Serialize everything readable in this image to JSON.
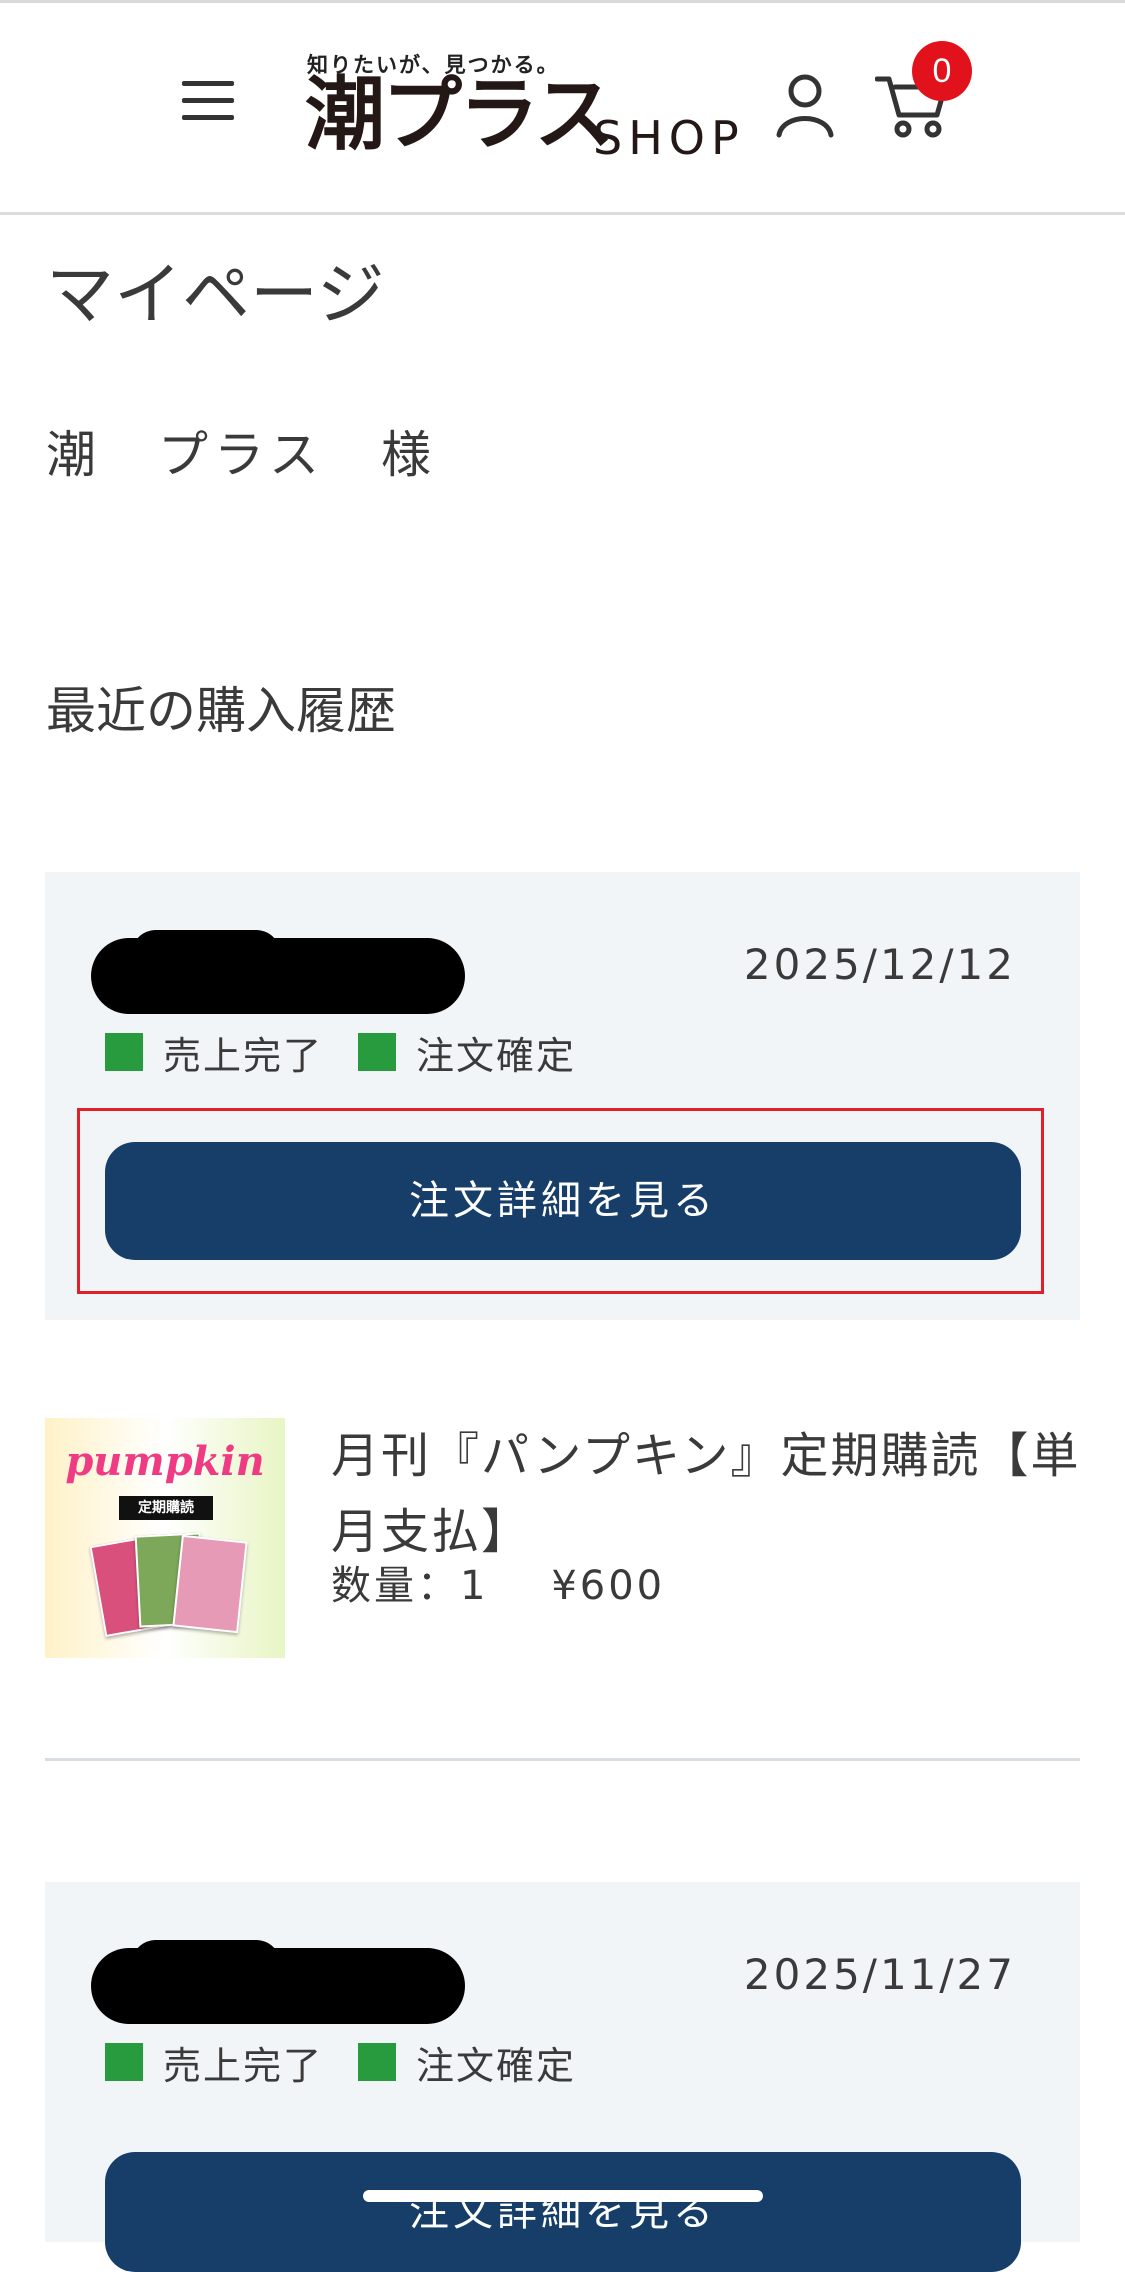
{
  "header": {
    "logo_tagline": "知りたいが、見つかる。",
    "logo_main": "潮プラス",
    "logo_shop": "SHOP",
    "cart_count": "0",
    "icons": {
      "menu": "hamburger-menu-icon",
      "user": "user-icon",
      "cart": "cart-icon"
    }
  },
  "page": {
    "title": "マイページ",
    "user_name": "潮　プラス　様",
    "section_title": "最近の購入履歴"
  },
  "orders": [
    {
      "date": "2025/12/12",
      "statuses": [
        "売上完了",
        "注文確定"
      ],
      "detail_label": "注文詳細を見る",
      "items": [
        {
          "name": "月刊『パンプキン』定期購読【単月支払】",
          "quantity_label": "数量：1",
          "price": "¥600"
        }
      ]
    },
    {
      "date": "2025/11/27",
      "statuses": [
        "売上完了",
        "注文確定"
      ],
      "detail_label": "注文詳細を見る"
    }
  ],
  "thumbnail": {
    "title": "pumpkin",
    "subtitle": "定期購読"
  },
  "colors": {
    "status_green": "#279b3d",
    "button_navy": "#173e69",
    "badge_red": "#e1121b",
    "card_bg": "#f2f5f8",
    "highlight_red": "#e0202a"
  }
}
